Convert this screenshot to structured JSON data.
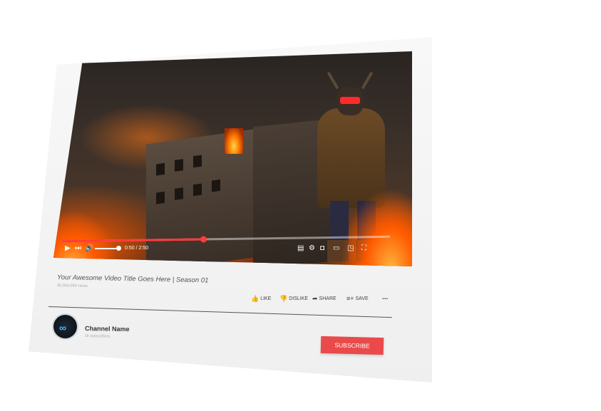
{
  "video": {
    "time": "0:50 / 2:50",
    "progress_fraction": 0.43,
    "volume_fraction": 1.0
  },
  "title": "Your Awesome Video Title Goes Here | Season 01",
  "views": "35,064,099 views",
  "actions": {
    "like": "LIKE",
    "dislike": "DISLIKE",
    "share": "SHARE",
    "save": "SAVE",
    "more": "..."
  },
  "channel": {
    "name": "Channel Name",
    "subscribers": "1k subscribers"
  },
  "subscribe_label": "SUBSCRIBE",
  "colors": {
    "accent": "#ea4a4a",
    "progress": "#ff3b3b",
    "logo": "#38c0ff"
  },
  "icons": {
    "play": "play-icon",
    "next": "next-icon",
    "volume": "volume-icon",
    "captions": "captions-icon",
    "settings": "gear-icon",
    "miniplayer": "miniplayer-icon",
    "theater": "theater-icon",
    "cast": "cast-icon",
    "fullscreen": "fullscreen-icon"
  }
}
